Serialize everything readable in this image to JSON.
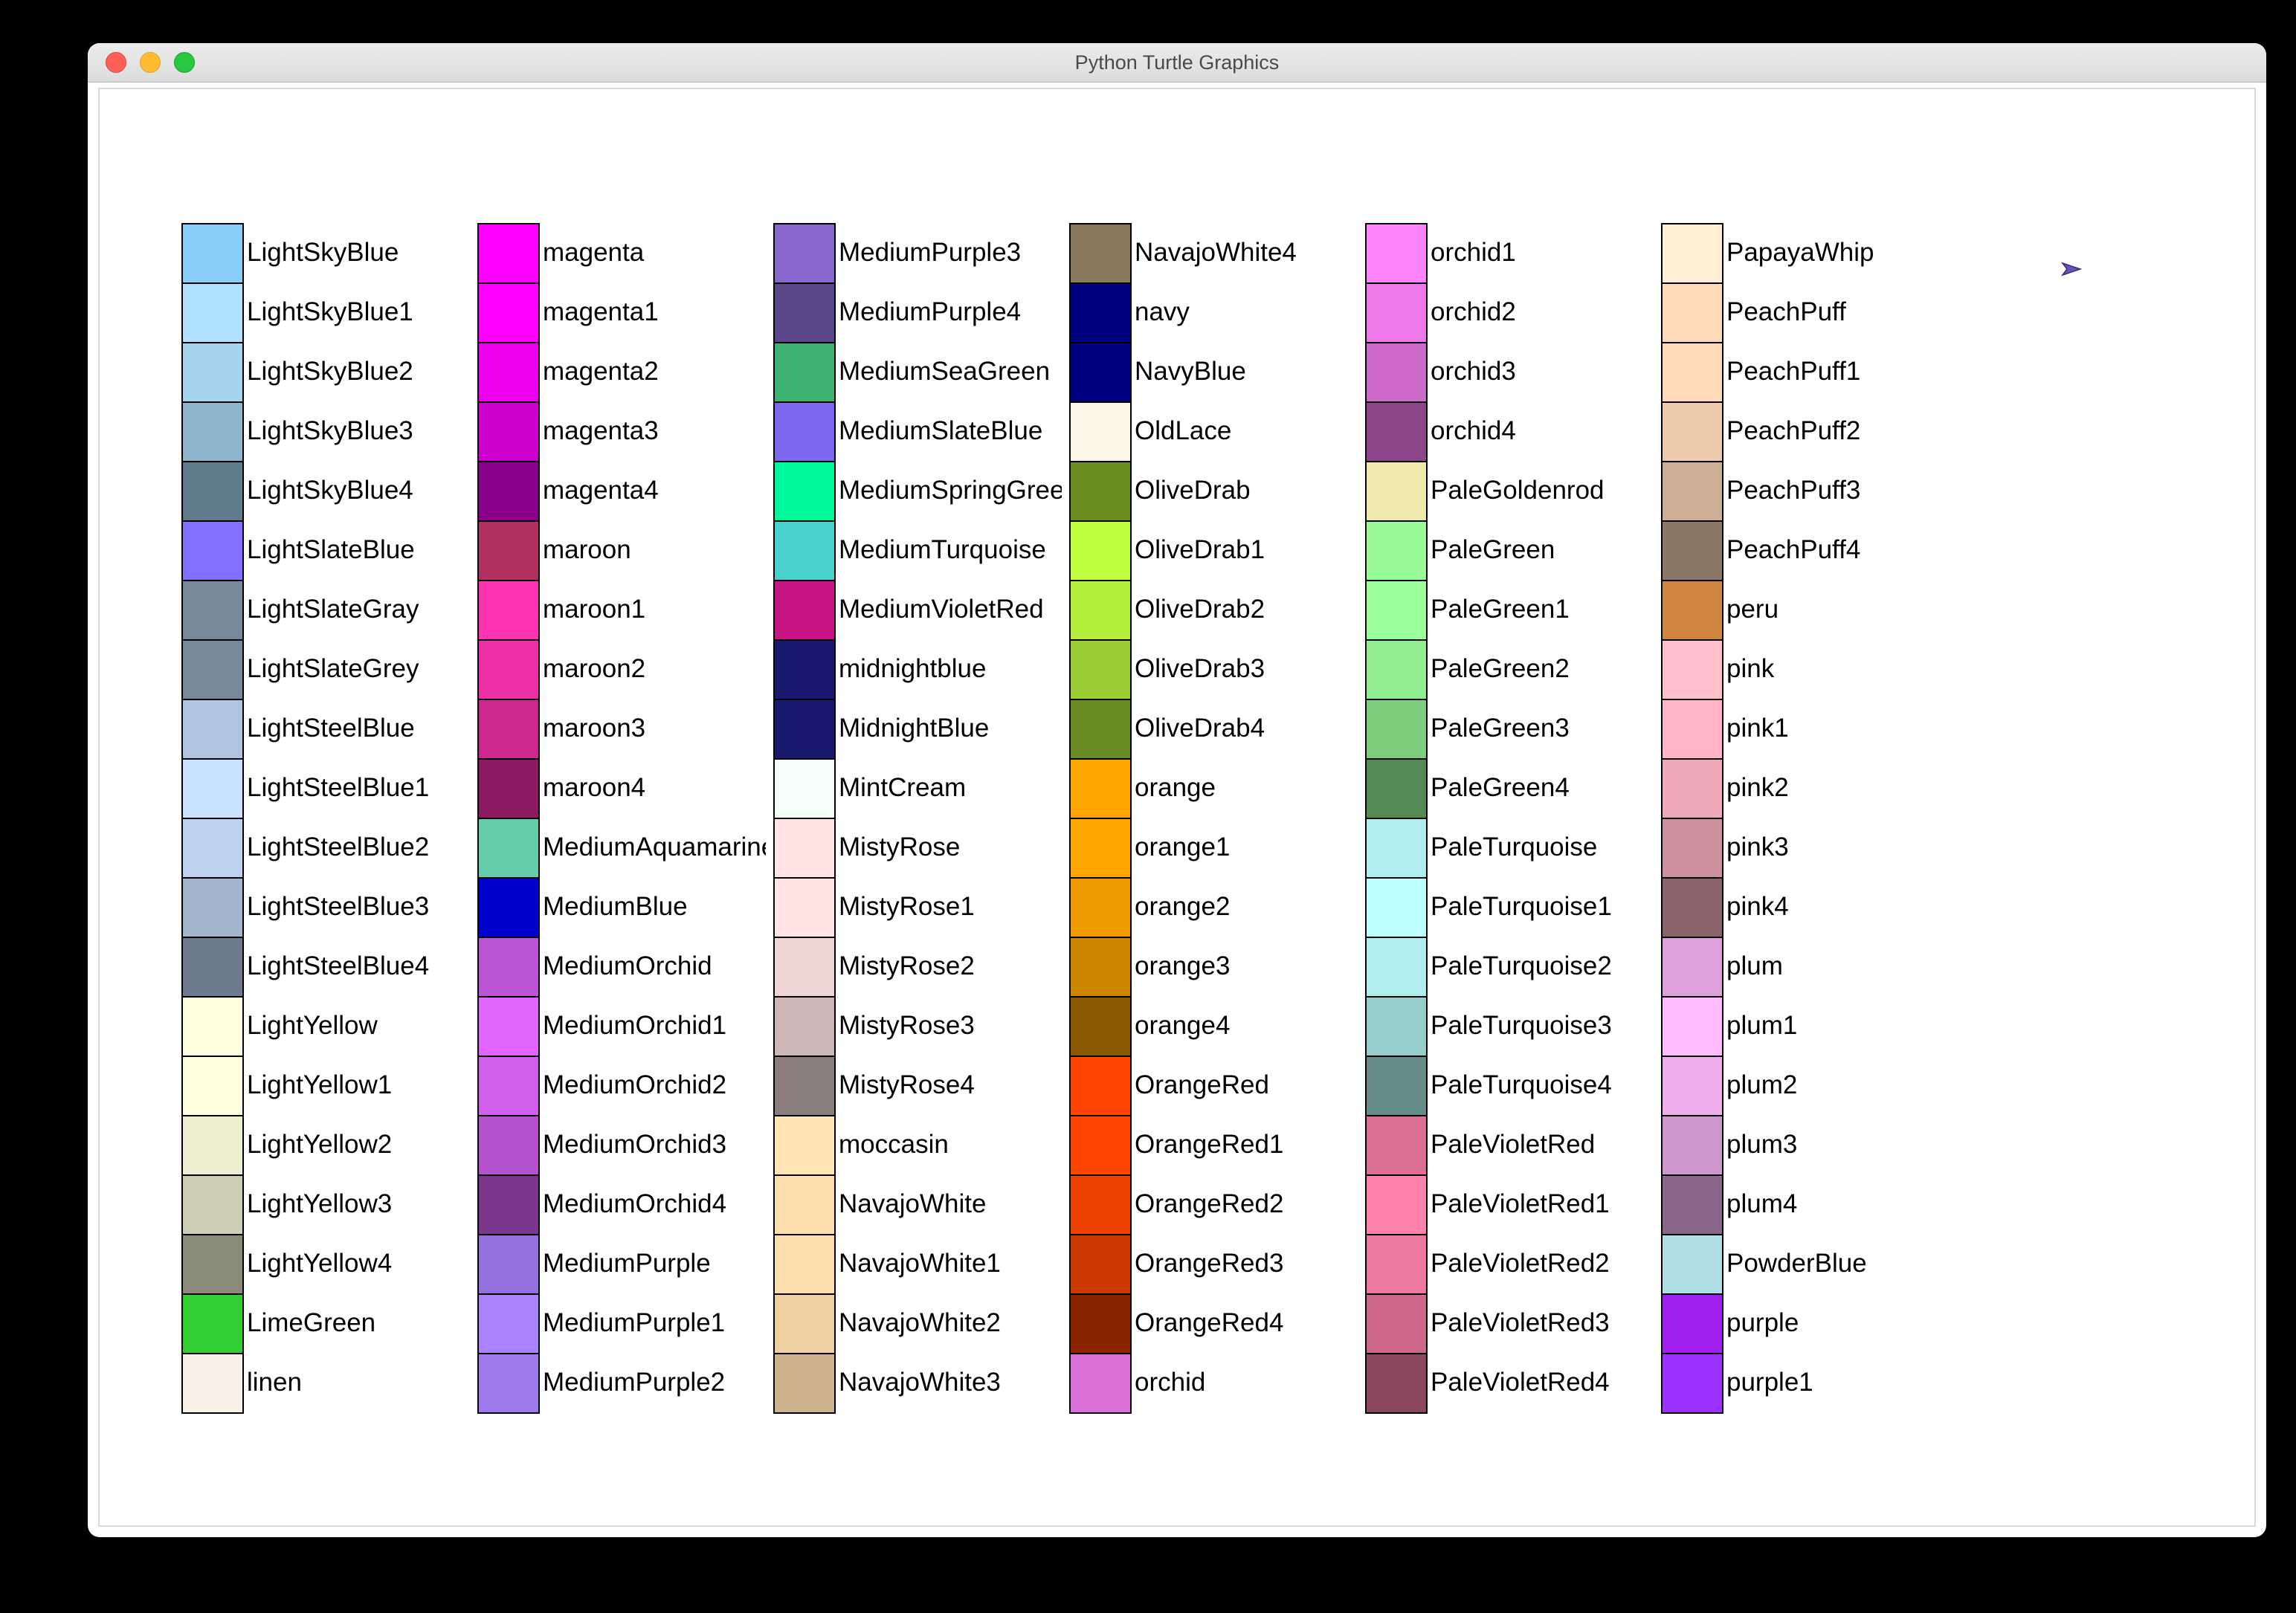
{
  "window": {
    "title": "Python Turtle Graphics"
  },
  "columns": [
    [
      {
        "name": "LightSkyBlue",
        "hex": "#87CEFA"
      },
      {
        "name": "LightSkyBlue1",
        "hex": "#B0E2FF"
      },
      {
        "name": "LightSkyBlue2",
        "hex": "#A4D3EE"
      },
      {
        "name": "LightSkyBlue3",
        "hex": "#8DB6CD"
      },
      {
        "name": "LightSkyBlue4",
        "hex": "#607B8B"
      },
      {
        "name": "LightSlateBlue",
        "hex": "#8470FF"
      },
      {
        "name": "LightSlateGray",
        "hex": "#778899"
      },
      {
        "name": "LightSlateGrey",
        "hex": "#778899"
      },
      {
        "name": "LightSteelBlue",
        "hex": "#B0C4DE"
      },
      {
        "name": "LightSteelBlue1",
        "hex": "#CAE1FF"
      },
      {
        "name": "LightSteelBlue2",
        "hex": "#BCD2EE"
      },
      {
        "name": "LightSteelBlue3",
        "hex": "#A2B5CD"
      },
      {
        "name": "LightSteelBlue4",
        "hex": "#6E7B8B"
      },
      {
        "name": "LightYellow",
        "hex": "#FFFFE0"
      },
      {
        "name": "LightYellow1",
        "hex": "#FFFFE0"
      },
      {
        "name": "LightYellow2",
        "hex": "#EEEED1"
      },
      {
        "name": "LightYellow3",
        "hex": "#CDCDB4"
      },
      {
        "name": "LightYellow4",
        "hex": "#8B8B7A"
      },
      {
        "name": "LimeGreen",
        "hex": "#32CD32"
      },
      {
        "name": "linen",
        "hex": "#FAF0E6"
      }
    ],
    [
      {
        "name": "magenta",
        "hex": "#FF00FF"
      },
      {
        "name": "magenta1",
        "hex": "#FF00FF"
      },
      {
        "name": "magenta2",
        "hex": "#EE00EE"
      },
      {
        "name": "magenta3",
        "hex": "#CD00CD"
      },
      {
        "name": "magenta4",
        "hex": "#8B008B"
      },
      {
        "name": "maroon",
        "hex": "#B03060"
      },
      {
        "name": "maroon1",
        "hex": "#FF34B3"
      },
      {
        "name": "maroon2",
        "hex": "#EE30A7"
      },
      {
        "name": "maroon3",
        "hex": "#CD2990"
      },
      {
        "name": "maroon4",
        "hex": "#8B1C62"
      },
      {
        "name": "MediumAquamarine",
        "hex": "#66CDAA"
      },
      {
        "name": "MediumBlue",
        "hex": "#0000CD"
      },
      {
        "name": "MediumOrchid",
        "hex": "#BA55D3"
      },
      {
        "name": "MediumOrchid1",
        "hex": "#E066FF"
      },
      {
        "name": "MediumOrchid2",
        "hex": "#D15FEE"
      },
      {
        "name": "MediumOrchid3",
        "hex": "#B452CD"
      },
      {
        "name": "MediumOrchid4",
        "hex": "#7A378B"
      },
      {
        "name": "MediumPurple",
        "hex": "#9370DB"
      },
      {
        "name": "MediumPurple1",
        "hex": "#AB82FF"
      },
      {
        "name": "MediumPurple2",
        "hex": "#9F79EE"
      }
    ],
    [
      {
        "name": "MediumPurple3",
        "hex": "#8968CD"
      },
      {
        "name": "MediumPurple4",
        "hex": "#5D478B"
      },
      {
        "name": "MediumSeaGreen",
        "hex": "#3CB371"
      },
      {
        "name": "MediumSlateBlue",
        "hex": "#7B68EE"
      },
      {
        "name": "MediumSpringGreen",
        "hex": "#00FA9A"
      },
      {
        "name": "MediumTurquoise",
        "hex": "#48D1CC"
      },
      {
        "name": "MediumVioletRed",
        "hex": "#C71585"
      },
      {
        "name": "midnightblue",
        "hex": "#191970"
      },
      {
        "name": "MidnightBlue",
        "hex": "#191970"
      },
      {
        "name": "MintCream",
        "hex": "#F5FFFA"
      },
      {
        "name": "MistyRose",
        "hex": "#FFE4E1"
      },
      {
        "name": "MistyRose1",
        "hex": "#FFE4E1"
      },
      {
        "name": "MistyRose2",
        "hex": "#EED5D2"
      },
      {
        "name": "MistyRose3",
        "hex": "#CDB7B5"
      },
      {
        "name": "MistyRose4",
        "hex": "#8B7D7B"
      },
      {
        "name": "moccasin",
        "hex": "#FFE4B5"
      },
      {
        "name": "NavajoWhite",
        "hex": "#FFDEAD"
      },
      {
        "name": "NavajoWhite1",
        "hex": "#FFDEAD"
      },
      {
        "name": "NavajoWhite2",
        "hex": "#EECFA1"
      },
      {
        "name": "NavajoWhite3",
        "hex": "#CDB38B"
      }
    ],
    [
      {
        "name": "NavajoWhite4",
        "hex": "#8B795E"
      },
      {
        "name": "navy",
        "hex": "#000080"
      },
      {
        "name": "NavyBlue",
        "hex": "#000080"
      },
      {
        "name": "OldLace",
        "hex": "#FDF5E6"
      },
      {
        "name": "OliveDrab",
        "hex": "#6B8E23"
      },
      {
        "name": "OliveDrab1",
        "hex": "#C0FF3E"
      },
      {
        "name": "OliveDrab2",
        "hex": "#B3EE3A"
      },
      {
        "name": "OliveDrab3",
        "hex": "#9ACD32"
      },
      {
        "name": "OliveDrab4",
        "hex": "#698B22"
      },
      {
        "name": "orange",
        "hex": "#FFA500"
      },
      {
        "name": "orange1",
        "hex": "#FFA500"
      },
      {
        "name": "orange2",
        "hex": "#EE9A00"
      },
      {
        "name": "orange3",
        "hex": "#CD8500"
      },
      {
        "name": "orange4",
        "hex": "#8B5A00"
      },
      {
        "name": "OrangeRed",
        "hex": "#FF4500"
      },
      {
        "name": "OrangeRed1",
        "hex": "#FF4500"
      },
      {
        "name": "OrangeRed2",
        "hex": "#EE4000"
      },
      {
        "name": "OrangeRed3",
        "hex": "#CD3700"
      },
      {
        "name": "OrangeRed4",
        "hex": "#8B2500"
      },
      {
        "name": "orchid",
        "hex": "#DA70D6"
      }
    ],
    [
      {
        "name": "orchid1",
        "hex": "#FF83FA"
      },
      {
        "name": "orchid2",
        "hex": "#EE7AE9"
      },
      {
        "name": "orchid3",
        "hex": "#CD69C9"
      },
      {
        "name": "orchid4",
        "hex": "#8B4789"
      },
      {
        "name": "PaleGoldenrod",
        "hex": "#EEE8AA"
      },
      {
        "name": "PaleGreen",
        "hex": "#98FB98"
      },
      {
        "name": "PaleGreen1",
        "hex": "#9AFF9A"
      },
      {
        "name": "PaleGreen2",
        "hex": "#90EE90"
      },
      {
        "name": "PaleGreen3",
        "hex": "#7CCD7C"
      },
      {
        "name": "PaleGreen4",
        "hex": "#548B54"
      },
      {
        "name": "PaleTurquoise",
        "hex": "#AFEEEE"
      },
      {
        "name": "PaleTurquoise1",
        "hex": "#BBFFFF"
      },
      {
        "name": "PaleTurquoise2",
        "hex": "#AEEEEE"
      },
      {
        "name": "PaleTurquoise3",
        "hex": "#96CDCD"
      },
      {
        "name": "PaleTurquoise4",
        "hex": "#668B8B"
      },
      {
        "name": "PaleVioletRed",
        "hex": "#DB7093"
      },
      {
        "name": "PaleVioletRed1",
        "hex": "#FF82AB"
      },
      {
        "name": "PaleVioletRed2",
        "hex": "#EE799F"
      },
      {
        "name": "PaleVioletRed3",
        "hex": "#CD6889"
      },
      {
        "name": "PaleVioletRed4",
        "hex": "#8B475D"
      }
    ],
    [
      {
        "name": "PapayaWhip",
        "hex": "#FFEFD5"
      },
      {
        "name": "PeachPuff",
        "hex": "#FFDAB9"
      },
      {
        "name": "PeachPuff1",
        "hex": "#FFDAB9"
      },
      {
        "name": "PeachPuff2",
        "hex": "#EECBAD"
      },
      {
        "name": "PeachPuff3",
        "hex": "#CDAF95"
      },
      {
        "name": "PeachPuff4",
        "hex": "#8B7765"
      },
      {
        "name": "peru",
        "hex": "#CD853F"
      },
      {
        "name": "pink",
        "hex": "#FFC0CB"
      },
      {
        "name": "pink1",
        "hex": "#FFB5C5"
      },
      {
        "name": "pink2",
        "hex": "#EEA9B8"
      },
      {
        "name": "pink3",
        "hex": "#CD919E"
      },
      {
        "name": "pink4",
        "hex": "#8B636C"
      },
      {
        "name": "plum",
        "hex": "#DDA0DD"
      },
      {
        "name": "plum1",
        "hex": "#FFBBFF"
      },
      {
        "name": "plum2",
        "hex": "#EEAEEE"
      },
      {
        "name": "plum3",
        "hex": "#CD96CD"
      },
      {
        "name": "plum4",
        "hex": "#8B668B"
      },
      {
        "name": "PowderBlue",
        "hex": "#B0E0E6"
      },
      {
        "name": "purple",
        "hex": "#A020F0"
      },
      {
        "name": "purple1",
        "hex": "#9B30FF"
      }
    ]
  ]
}
